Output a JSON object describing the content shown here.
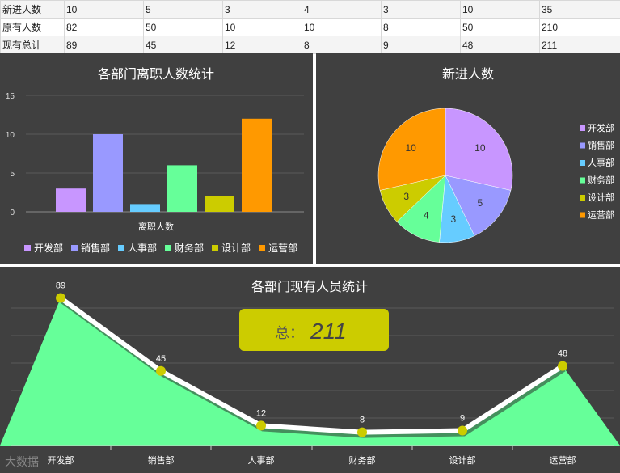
{
  "sheet": {
    "rows": [
      {
        "label": "新进人数",
        "cells": [
          "10",
          "5",
          "3",
          "4",
          "3",
          "10",
          "35"
        ]
      },
      {
        "label": "原有人数",
        "cells": [
          "82",
          "50",
          "10",
          "10",
          "8",
          "50",
          "210"
        ]
      },
      {
        "label": "现有总计",
        "cells": [
          "89",
          "45",
          "12",
          "8",
          "9",
          "48",
          "211"
        ]
      }
    ]
  },
  "chart_data": [
    {
      "type": "bar",
      "title": "各部门离职人数统计",
      "xlabel": "离职人数",
      "ylabel": "",
      "ylim": [
        0,
        15
      ],
      "yticks": [
        "0",
        "5",
        "10",
        "15"
      ],
      "grid": true,
      "legend": "bottom",
      "categories": [
        "开发部",
        "销售部",
        "人事部",
        "财务部",
        "设计部",
        "运营部"
      ],
      "values": [
        3,
        10,
        1,
        6,
        2,
        12
      ],
      "colors": [
        "#c896ff",
        "#9999ff",
        "#66ccff",
        "#66ff99",
        "#cccc00",
        "#ff9900"
      ]
    },
    {
      "type": "pie",
      "title": "新进人数",
      "legend": "right",
      "categories": [
        "开发部",
        "销售部",
        "人事部",
        "财务部",
        "设计部",
        "运营部"
      ],
      "values": [
        10,
        5,
        3,
        4,
        3,
        10
      ],
      "colors": [
        "#c896ff",
        "#9999ff",
        "#66ccff",
        "#66ff99",
        "#cccc00",
        "#ff9900"
      ]
    },
    {
      "type": "area",
      "title": "各部门现有人员统计",
      "categories": [
        "开发部",
        "销售部",
        "人事部",
        "财务部",
        "设计部",
        "运营部"
      ],
      "values": [
        89,
        45,
        12,
        8,
        9,
        48
      ],
      "ylim": [
        0,
        100
      ],
      "grid": true,
      "fill_color": "#66ff99",
      "line_color": "#ffffff",
      "marker_color": "#cccc00",
      "total_label": "总：",
      "total_value": "211",
      "badge_color": "#cccc00"
    }
  ],
  "watermark": "大数据"
}
